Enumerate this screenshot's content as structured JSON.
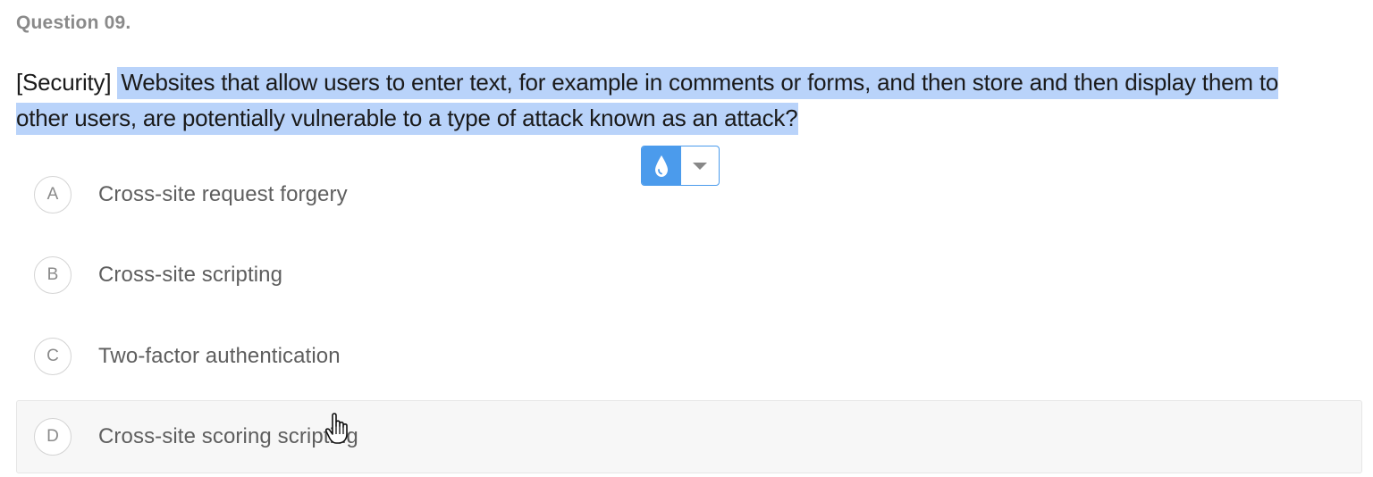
{
  "question": {
    "number": "Question 09.",
    "tag": "[Security]",
    "text_line1": "Websites that allow users to enter text, for example in comments or forms, and then store and then display them to",
    "text_line2": "other users, are potentially vulnerable to a type of attack known as an attack?"
  },
  "toolbar": {
    "highlight_icon": "water-drop-icon",
    "dropdown_icon": "caret-down-icon",
    "accent_color": "#4b9bec"
  },
  "options": [
    {
      "letter": "A",
      "label": "Cross-site request forgery"
    },
    {
      "letter": "B",
      "label": "Cross-site scripting"
    },
    {
      "letter": "C",
      "label": "Two-factor authentication"
    },
    {
      "letter": "D",
      "label": "Cross-site scoring scripting"
    }
  ],
  "colors": {
    "selection_highlight": "#b9d3fa",
    "hover_background": "#f7f7f7"
  }
}
